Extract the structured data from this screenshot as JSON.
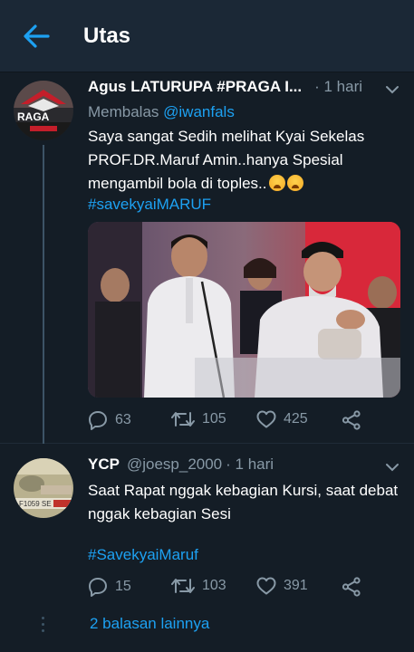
{
  "header": {
    "title": "Utas"
  },
  "tweets": [
    {
      "display_name": "Agus LATURUPA #PRAGA I...",
      "handle": "",
      "time": "· 1 hari",
      "reply_prefix": "Membalas ",
      "reply_handle": "@iwanfals",
      "body": "Saya sangat Sedih melihat Kyai Sekelas PROF.DR.Maruf Amin..hanya Spesial mengambil bola di toples..",
      "hashtag": "#savekyaiMARUF",
      "avatar_text": "RAGA",
      "replies": "63",
      "retweets": "105",
      "likes": "425"
    },
    {
      "display_name": "YCP",
      "handle": "@joesp_2000",
      "time": "· 1 hari",
      "body": "Saat Rapat nggak kebagian Kursi, saat debat nggak kebagian Sesi",
      "hashtag": "#SavekyaiMaruf",
      "replies": "15",
      "retweets": "103",
      "likes": "391"
    }
  ],
  "more_replies": "2 balasan lainnya",
  "colors": {
    "background": "#141d26",
    "header": "#1b2836",
    "accent": "#1da1f2",
    "muted": "#8899a6"
  },
  "icons": [
    "back-arrow-icon",
    "chevron-down-icon",
    "reply-icon",
    "retweet-icon",
    "like-icon",
    "share-icon"
  ]
}
